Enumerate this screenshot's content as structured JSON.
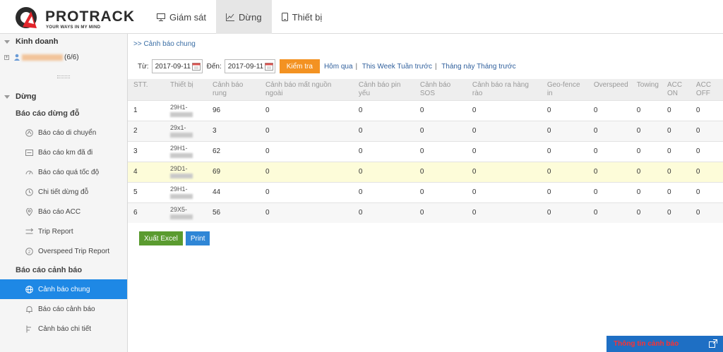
{
  "header": {
    "logo_text": "PROTRACK",
    "logo_tagline": "YOUR WAYS IN MY MIND",
    "nav": [
      {
        "label": "Giám sát",
        "icon": "monitor-icon",
        "active": false
      },
      {
        "label": "Dừng",
        "icon": "chart-icon",
        "active": true
      },
      {
        "label": "Thiết bị",
        "icon": "phone-icon",
        "active": false
      }
    ]
  },
  "sidebar": {
    "business_title": "Kinh doanh",
    "account_suffix": "(6/6)",
    "stop_title": "Dừng",
    "group1": "Báo cáo dừng đỗ",
    "group1_items": [
      {
        "label": "Báo cáo di chuyển",
        "icon": "route-icon"
      },
      {
        "label": "Báo cáo km đã đi",
        "icon": "odometer-icon"
      },
      {
        "label": "Báo cáo quá tốc độ",
        "icon": "speedometer-icon"
      },
      {
        "label": "Chi tiết dừng đỗ",
        "icon": "clock-icon"
      },
      {
        "label": "Báo cáo ACC",
        "icon": "pin-icon"
      },
      {
        "label": "Trip Report",
        "icon": "trip-icon"
      },
      {
        "label": "Overspeed Trip Report",
        "icon": "overspeed-icon"
      }
    ],
    "group2": "Báo cáo cảnh báo",
    "group2_items": [
      {
        "label": "Cảnh báo chung",
        "icon": "globe-icon",
        "active": true
      },
      {
        "label": "Báo cáo cảnh báo",
        "icon": "bell-icon",
        "active": false
      },
      {
        "label": "Cảnh báo chi tiết",
        "icon": "detail-icon",
        "active": false
      }
    ]
  },
  "breadcrumb": ">> Cảnh báo chung",
  "filter": {
    "from_label": "Từ:",
    "from_value": "2017-09-11",
    "to_label": "Đến:",
    "to_value": "2017-09-11",
    "check_button": "Kiểm tra",
    "links": [
      "Hôm qua",
      "This Week",
      "Tuần trước",
      "Tháng này",
      "Tháng trước"
    ]
  },
  "table": {
    "headers": [
      "STT.",
      "Thiết bị",
      "Cảnh báo rung",
      "Cảnh báo mất nguồn ngoài",
      "Cảnh báo pin yếu",
      "Cảnh báo SOS",
      "Cảnh báo ra hàng rào",
      "Geo-fence in",
      "Overspeed",
      "Towing",
      "ACC ON",
      "ACC OFF"
    ],
    "rows": [
      {
        "stt": "1",
        "device": "29H1-",
        "vals": [
          "96",
          "0",
          "0",
          "0",
          "0",
          "0",
          "0",
          "0",
          "0",
          "0"
        ]
      },
      {
        "stt": "2",
        "device": "29x1-",
        "vals": [
          "3",
          "0",
          "0",
          "0",
          "0",
          "0",
          "0",
          "0",
          "0",
          "0"
        ]
      },
      {
        "stt": "3",
        "device": "29H1-",
        "vals": [
          "62",
          "0",
          "0",
          "0",
          "0",
          "0",
          "0",
          "0",
          "0",
          "0"
        ]
      },
      {
        "stt": "4",
        "device": "29D1-",
        "vals": [
          "69",
          "0",
          "0",
          "0",
          "0",
          "0",
          "0",
          "0",
          "0",
          "0"
        ]
      },
      {
        "stt": "5",
        "device": "29H1-",
        "vals": [
          "44",
          "0",
          "0",
          "0",
          "0",
          "0",
          "0",
          "0",
          "0",
          "0"
        ]
      },
      {
        "stt": "6",
        "device": "29X5-",
        "vals": [
          "56",
          "0",
          "0",
          "0",
          "0",
          "0",
          "0",
          "0",
          "0",
          "0"
        ]
      }
    ],
    "highlight_row": 4
  },
  "actions": {
    "excel": "Xuất Excel",
    "print": "Print"
  },
  "alert_bar": "Thông tin cảnh báo",
  "colors": {
    "accent": "#1e88e5",
    "check": "#f39222",
    "excel": "#5a9b2f",
    "print": "#2f86d6",
    "highlight": "#fdfcd9"
  }
}
